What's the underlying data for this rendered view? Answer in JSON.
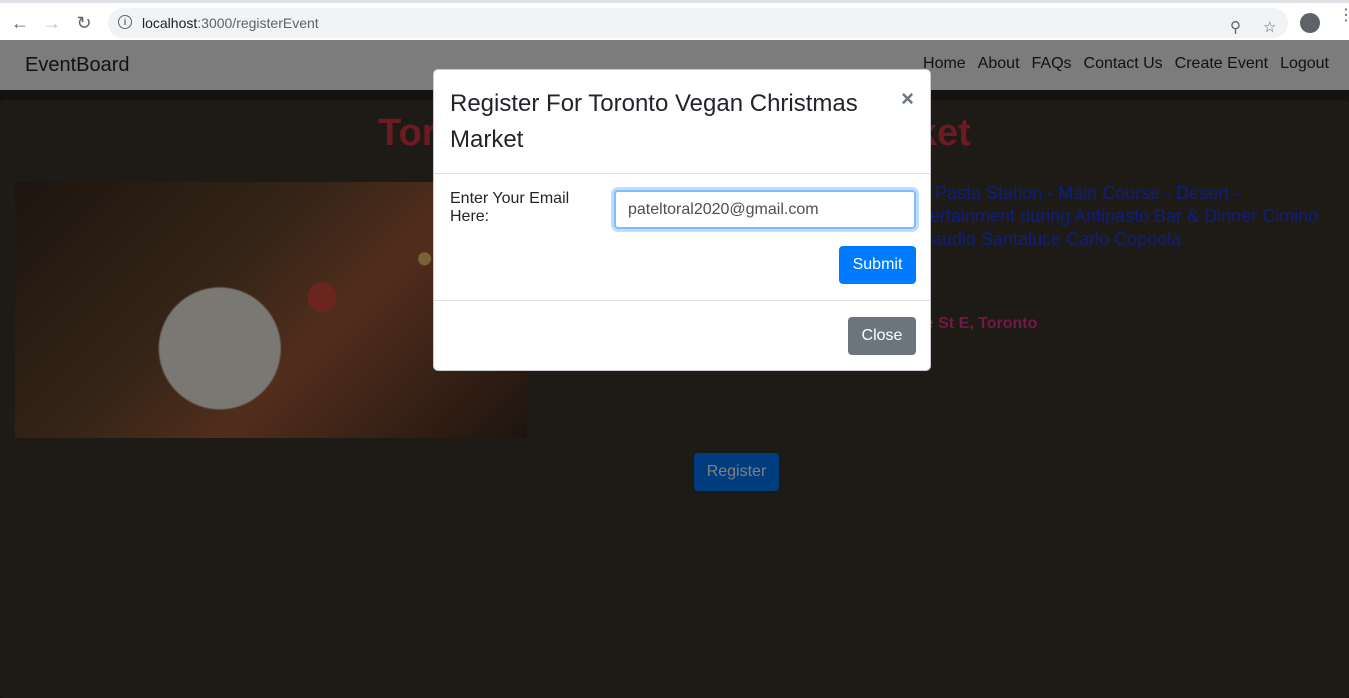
{
  "browser": {
    "url_host": "localhost",
    "url_path": ":3000/registerEvent"
  },
  "navbar": {
    "brand": "EventBoard",
    "links": [
      "Home",
      "About",
      "FAQs",
      "Contact Us",
      "Create Event",
      "Logout"
    ]
  },
  "event": {
    "title": "Toronto Vegan Christmas Market",
    "description": "th Pasta Station - Main Course - Desert - ntertainment during Antipasto Bar & Dinner Cimino Claudio Santaluce Carlo Copoola",
    "location": "de St E, Toronto",
    "register_label": "Register"
  },
  "modal": {
    "title": "Register For Toronto Vegan Christmas Market",
    "close_symbol": "×",
    "email_label": "Enter Your Email Here:",
    "email_value": "pateltoral2020@gmail.com",
    "submit_label": "Submit",
    "close_label": "Close"
  }
}
